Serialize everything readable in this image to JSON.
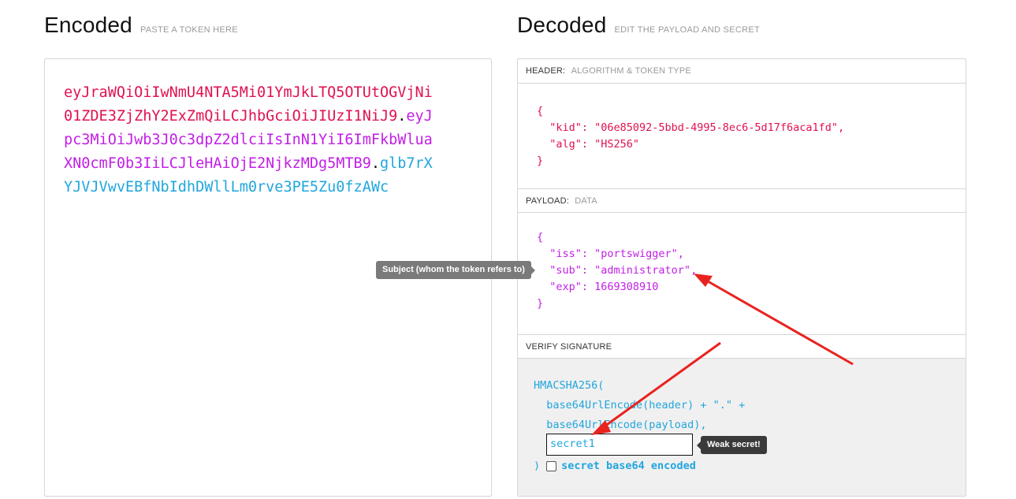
{
  "encoded": {
    "title": "Encoded",
    "subtitle": "PASTE A TOKEN HERE",
    "token_header": "eyJraWQiOiIwNmU4NTA5Mi01YmJkLTQ5OTUtOGVjNi01ZDE3ZjZhY2ExZmQiLCJhbGciOiJIUzI1NiJ9",
    "token_payload": "eyJpc3MiOiJwb3J0c3dpZ2dlciIsInN1YiI6ImFkbWluaXN0cmF0b3IiLCJleHAiOjE2NjkzMDg5MTB9",
    "token_signature": "glb7rXYJVJVwvEBfNbIdhDWllLm0rve3PE5Zu0fzAWc",
    "dot": "."
  },
  "decoded": {
    "title": "Decoded",
    "subtitle": "EDIT THE PAYLOAD AND SECRET",
    "header_section": {
      "label": "HEADER:",
      "desc": "ALGORITHM & TOKEN TYPE",
      "lines": [
        "{",
        "  \"kid\": \"06e85092-5bbd-4995-8ec6-5d17f6aca1fd\",",
        "  \"alg\": \"HS256\"",
        "}"
      ]
    },
    "payload_section": {
      "label": "PAYLOAD:",
      "desc": "DATA",
      "lines": [
        "{",
        "  \"iss\": \"portswigger\",",
        "  \"sub\": \"administrator\",",
        "  \"exp\": 1669308910",
        "}"
      ]
    },
    "signature_section": {
      "label": "VERIFY SIGNATURE",
      "lines": [
        "HMACSHA256(",
        "  base64UrlEncode(header) + \".\" +",
        "  base64UrlEncode(payload),"
      ],
      "secret_value": "secret1",
      "weak_tip": "Weak secret!",
      "close_paren": ")",
      "b64_label": "secret base64 encoded",
      "b64_checked": false
    }
  },
  "tooltip_subject": "Subject (whom the token refers to)",
  "colors": {
    "header": "#e0124f",
    "payload": "#c21fe6",
    "signature": "#21a6dd",
    "arrow": "#e8231f"
  }
}
